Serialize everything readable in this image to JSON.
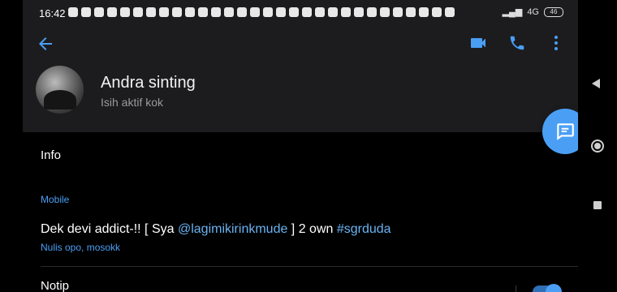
{
  "status": {
    "time": "16:42",
    "network": "4G",
    "battery": "46"
  },
  "header": {
    "contact_name": "Andra sinting",
    "contact_status": "Isih aktif kok",
    "icons": [
      "back-arrow-icon",
      "video-call-icon",
      "phone-icon",
      "more-vert-icon"
    ]
  },
  "info": {
    "section_title": "Info",
    "mobile_label": "Mobile",
    "bio_prefix": "Dek devi addict-!! [ Sya ",
    "bio_mention": "@lagimikirinkmude",
    "bio_middle": " ] 2 own ",
    "bio_hashtag": "#sgrduda",
    "bio_sub": "Nulis opo, mosokk"
  },
  "notifications": {
    "label": "Notip",
    "enabled": true
  },
  "colors": {
    "accent": "#4a9ff5",
    "header_bg": "#1c1c1e",
    "background": "#000000"
  }
}
